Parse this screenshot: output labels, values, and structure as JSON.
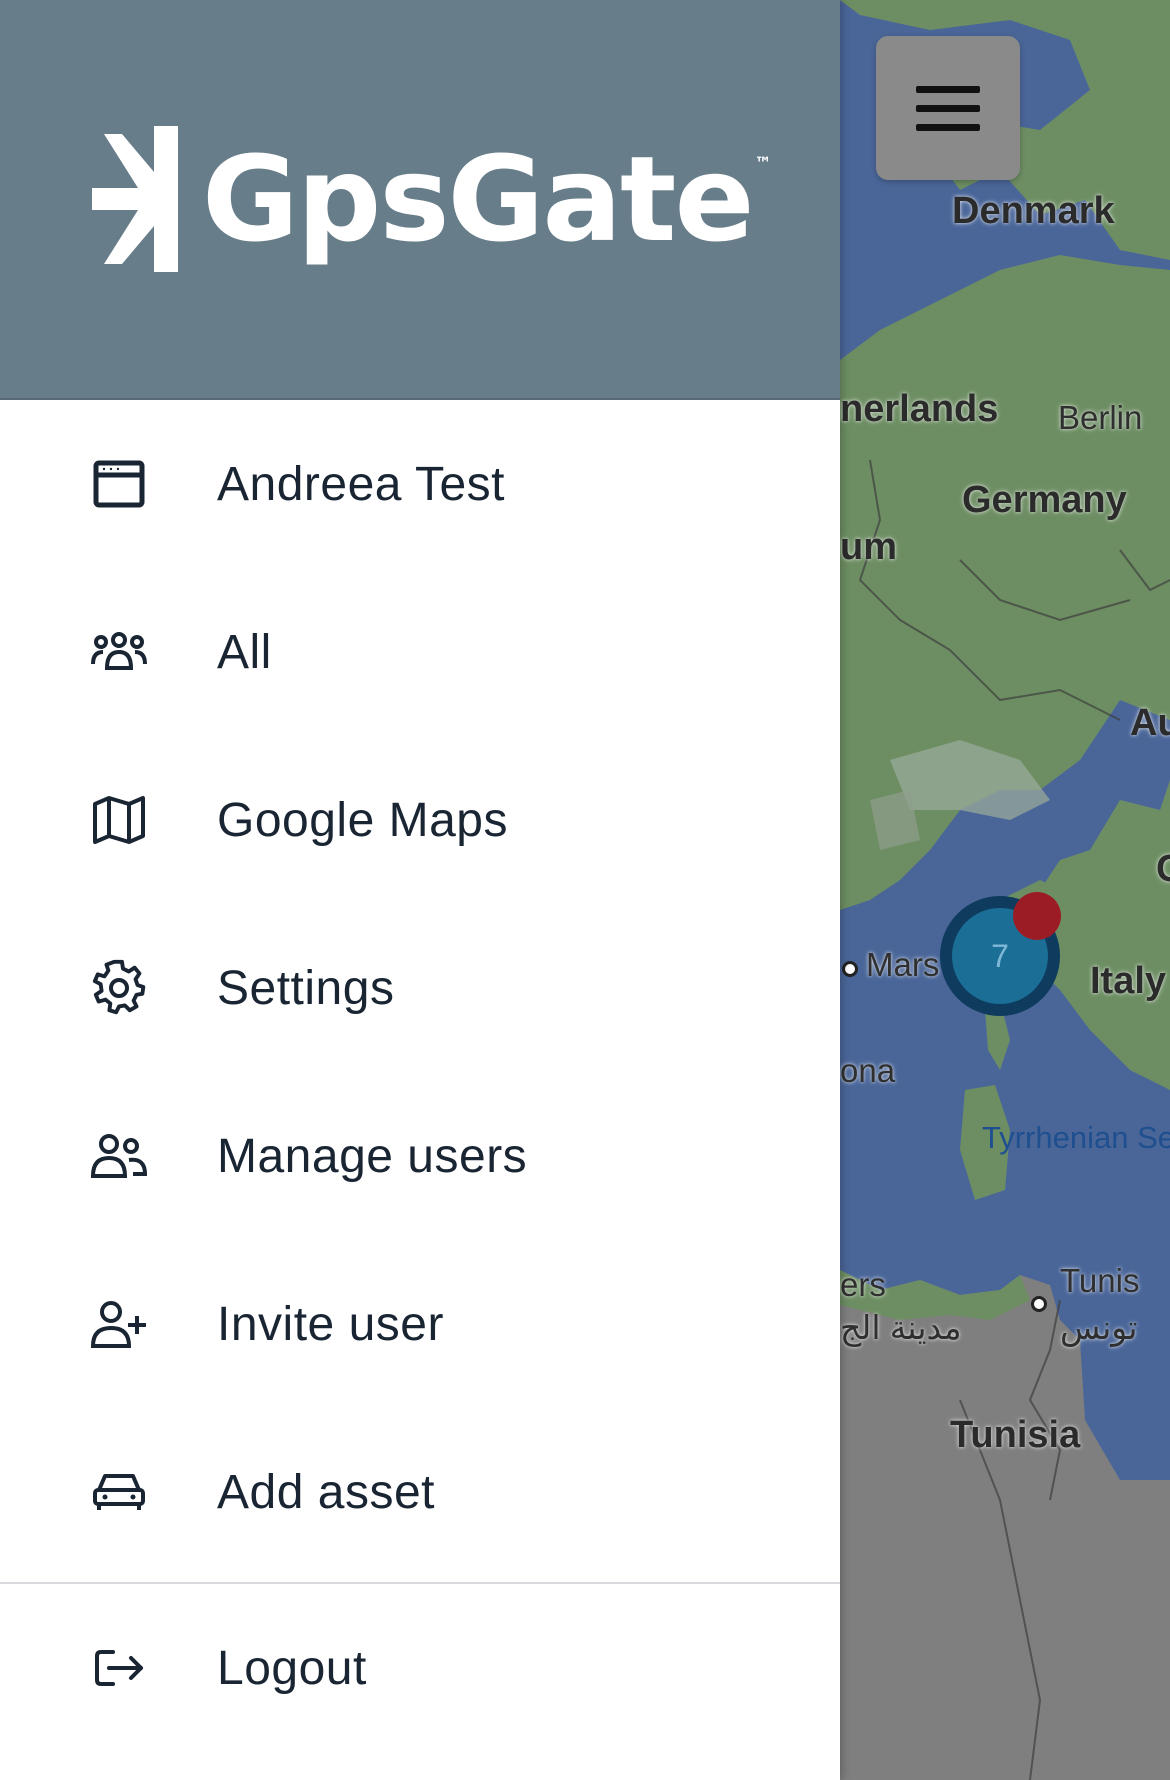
{
  "app": {
    "logo_text": "GpsGate",
    "logo_tm": "™"
  },
  "menu": {
    "items": [
      {
        "icon": "browser-window-icon",
        "label": "Andreea Test"
      },
      {
        "icon": "users-group-icon",
        "label": "All"
      },
      {
        "icon": "map-icon",
        "label": "Google Maps"
      },
      {
        "icon": "gear-icon",
        "label": "Settings"
      },
      {
        "icon": "manage-users-icon",
        "label": "Manage users"
      },
      {
        "icon": "user-plus-icon",
        "label": "Invite user"
      },
      {
        "icon": "car-icon",
        "label": "Add asset"
      }
    ],
    "logout": {
      "icon": "logout-icon",
      "label": "Logout"
    }
  },
  "map": {
    "labels": {
      "denmark": "Denmark",
      "netherlands": "nerlands",
      "berlin": "Berlin",
      "germany": "Germany",
      "belgium": "um",
      "austria": "Au",
      "marseille": "Mars",
      "italy": "Italy",
      "barcelona": "ona",
      "tyrrhenian": "Tyrrhenian Se",
      "algiers": "ers",
      "algiers_ar": "مدينة الج",
      "tunis": "Tunis",
      "tunis_ar": "تونس",
      "tunisia": "Tunisia",
      "croatia": "C"
    },
    "cluster": {
      "count": "7"
    }
  },
  "colors": {
    "header": "#687d8a",
    "sea": "#4a6699",
    "land": "#6d8e63",
    "cluster": "#1b6f96",
    "alert": "#9b1c25"
  }
}
